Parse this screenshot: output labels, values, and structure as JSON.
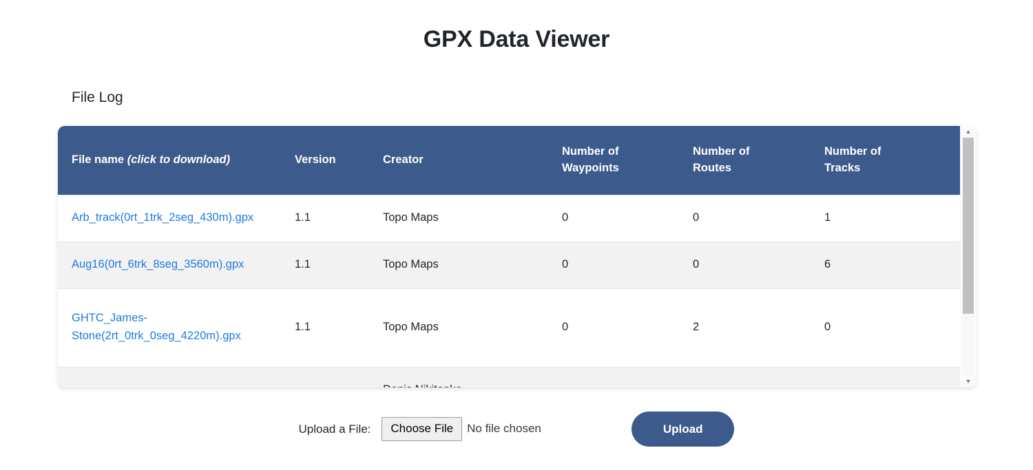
{
  "app": {
    "title": "GPX Data Viewer"
  },
  "file_log": {
    "heading": "File Log",
    "columns": {
      "file_name": "File name ",
      "file_name_italic": "(click to download)",
      "version": "Version",
      "creator": "Creator",
      "waypoints_line1": "Number of",
      "waypoints_line2": "Waypoints",
      "routes_line1": "Number of",
      "routes_line2": "Routes",
      "tracks_line1": "Number of",
      "tracks_line2": "Tracks"
    },
    "rows": [
      {
        "file_name": "Arb_track(0rt_1trk_2seg_430m).gpx",
        "version": "1.1",
        "creator": "Topo Maps",
        "waypoints": "0",
        "routes": "0",
        "tracks": "1"
      },
      {
        "file_name": "Aug16(0rt_6trk_8seg_3560m).gpx",
        "version": "1.1",
        "creator": "Topo Maps",
        "waypoints": "0",
        "routes": "0",
        "tracks": "6"
      },
      {
        "file_name": "GHTC_James-Stone(2rt_0trk_0seg_4220m).gpx",
        "version": "1.1",
        "creator": "Topo Maps",
        "waypoints": "0",
        "routes": "2",
        "tracks": "0"
      },
      {
        "file_name": "",
        "version": "",
        "creator": "Denis Nikitenko",
        "waypoints": "",
        "routes": "",
        "tracks": ""
      }
    ],
    "scrollbar": {
      "up_arrow": "▲",
      "down_arrow": "▼"
    }
  },
  "upload": {
    "label": "Upload a File:",
    "choose_file_label": "Choose File",
    "no_file_text": "No file chosen",
    "submit_label": "Upload"
  },
  "colors": {
    "header_blue": "#3d5a8c",
    "link_blue": "#1f7ae0",
    "stripe_gray": "#f2f2f2"
  }
}
